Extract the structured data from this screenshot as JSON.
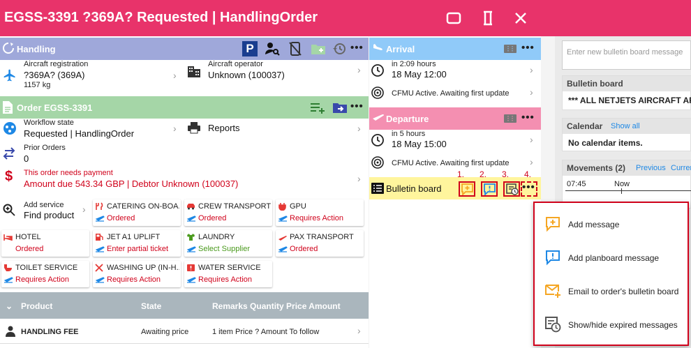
{
  "window": {
    "title": "EGSS-3391 ?369A? Requested | HandlingOrder"
  },
  "handling": {
    "header": "Handling",
    "registration_label": "Aircraft registration",
    "registration_value": "?369A? (369A)",
    "registration_weight": "1157 kg",
    "operator_label": "Aircraft operator",
    "operator_value": "Unknown (100037)"
  },
  "order": {
    "header": "Order EGSS-3391",
    "workflow_label": "Workflow state",
    "workflow_value": "Requested | HandlingOrder",
    "reports_label": "Reports",
    "prior_label": "Prior Orders",
    "prior_value": "0",
    "payment_label": "This order needs payment",
    "payment_value": "Amount due 543.34 GBP | Debtor Unknown (100037)",
    "add_service_label": "Add service",
    "find_product_label": "Find product"
  },
  "services": [
    {
      "name": "CATERING ON-BOA...",
      "status": "Ordered"
    },
    {
      "name": "CREW TRANSPORT",
      "status": "Ordered"
    },
    {
      "name": "GPU",
      "status": "Requires Action"
    },
    {
      "name": "HOTEL",
      "status": "Ordered"
    },
    {
      "name": "JET A1 UPLIFT",
      "status": "Enter partial ticket"
    },
    {
      "name": "LAUNDRY",
      "status": "Select Supplier"
    },
    {
      "name": "PAX TRANSPORT",
      "status": "Ordered"
    },
    {
      "name": "TOILET SERVICE",
      "status": "Requires Action"
    },
    {
      "name": "WASHING UP (IN-H...",
      "status": "Requires Action"
    },
    {
      "name": "WATER SERVICE",
      "status": "Requires Action"
    }
  ],
  "table": {
    "headers": {
      "product": "Product",
      "state": "State",
      "rest": "Remarks Quantity Price Amount"
    },
    "rows": [
      {
        "product": "HANDLING FEE",
        "state": "Awaiting price",
        "details": "1 item Price ? Amount To follow"
      }
    ]
  },
  "arrival": {
    "header": "Arrival",
    "eta_label": "in 2:09 hours",
    "eta_value": "18 May 12:00",
    "cfmu": "CFMU Active. Awaiting first update"
  },
  "departure": {
    "header": "Departure",
    "etd_label": "in 5 hours",
    "etd_value": "18 May 15:00",
    "cfmu": "CFMU Active. Awaiting first update"
  },
  "bulletin": {
    "header": "Bulletin board",
    "annotations": [
      "1.",
      "2.",
      "3.",
      "4."
    ]
  },
  "right_panel": {
    "input_placeholder": "Enter new bulletin board message",
    "bulletin_header": "Bulletin board",
    "bulletin_message": "*** ALL NETJETS AIRCRAFT ARE",
    "calendar_header": "Calendar",
    "calendar_link": "Show all",
    "calendar_empty": "No calendar items.",
    "movements_header": "Movements (2)",
    "movements_prev": "Previous",
    "movements_curr": "Curren",
    "time_label": "07:45",
    "now_label": "Now"
  },
  "popup_menu": [
    {
      "label": "Add message",
      "icon": "add-message-icon"
    },
    {
      "label": "Add planboard message",
      "icon": "planboard-message-icon"
    },
    {
      "label": "Email to order's bulletin board",
      "icon": "email-icon"
    },
    {
      "label": "Show/hide expired messages",
      "icon": "expired-messages-icon"
    }
  ],
  "colors": {
    "titlebar": "#e8336a",
    "handling_header": "#9fa8da",
    "order_header": "#a5d6a7",
    "arrival_header": "#90caf9",
    "departure_header": "#f48fb1",
    "bulletin_header": "#fff59d",
    "alert_red": "#d0021b"
  }
}
